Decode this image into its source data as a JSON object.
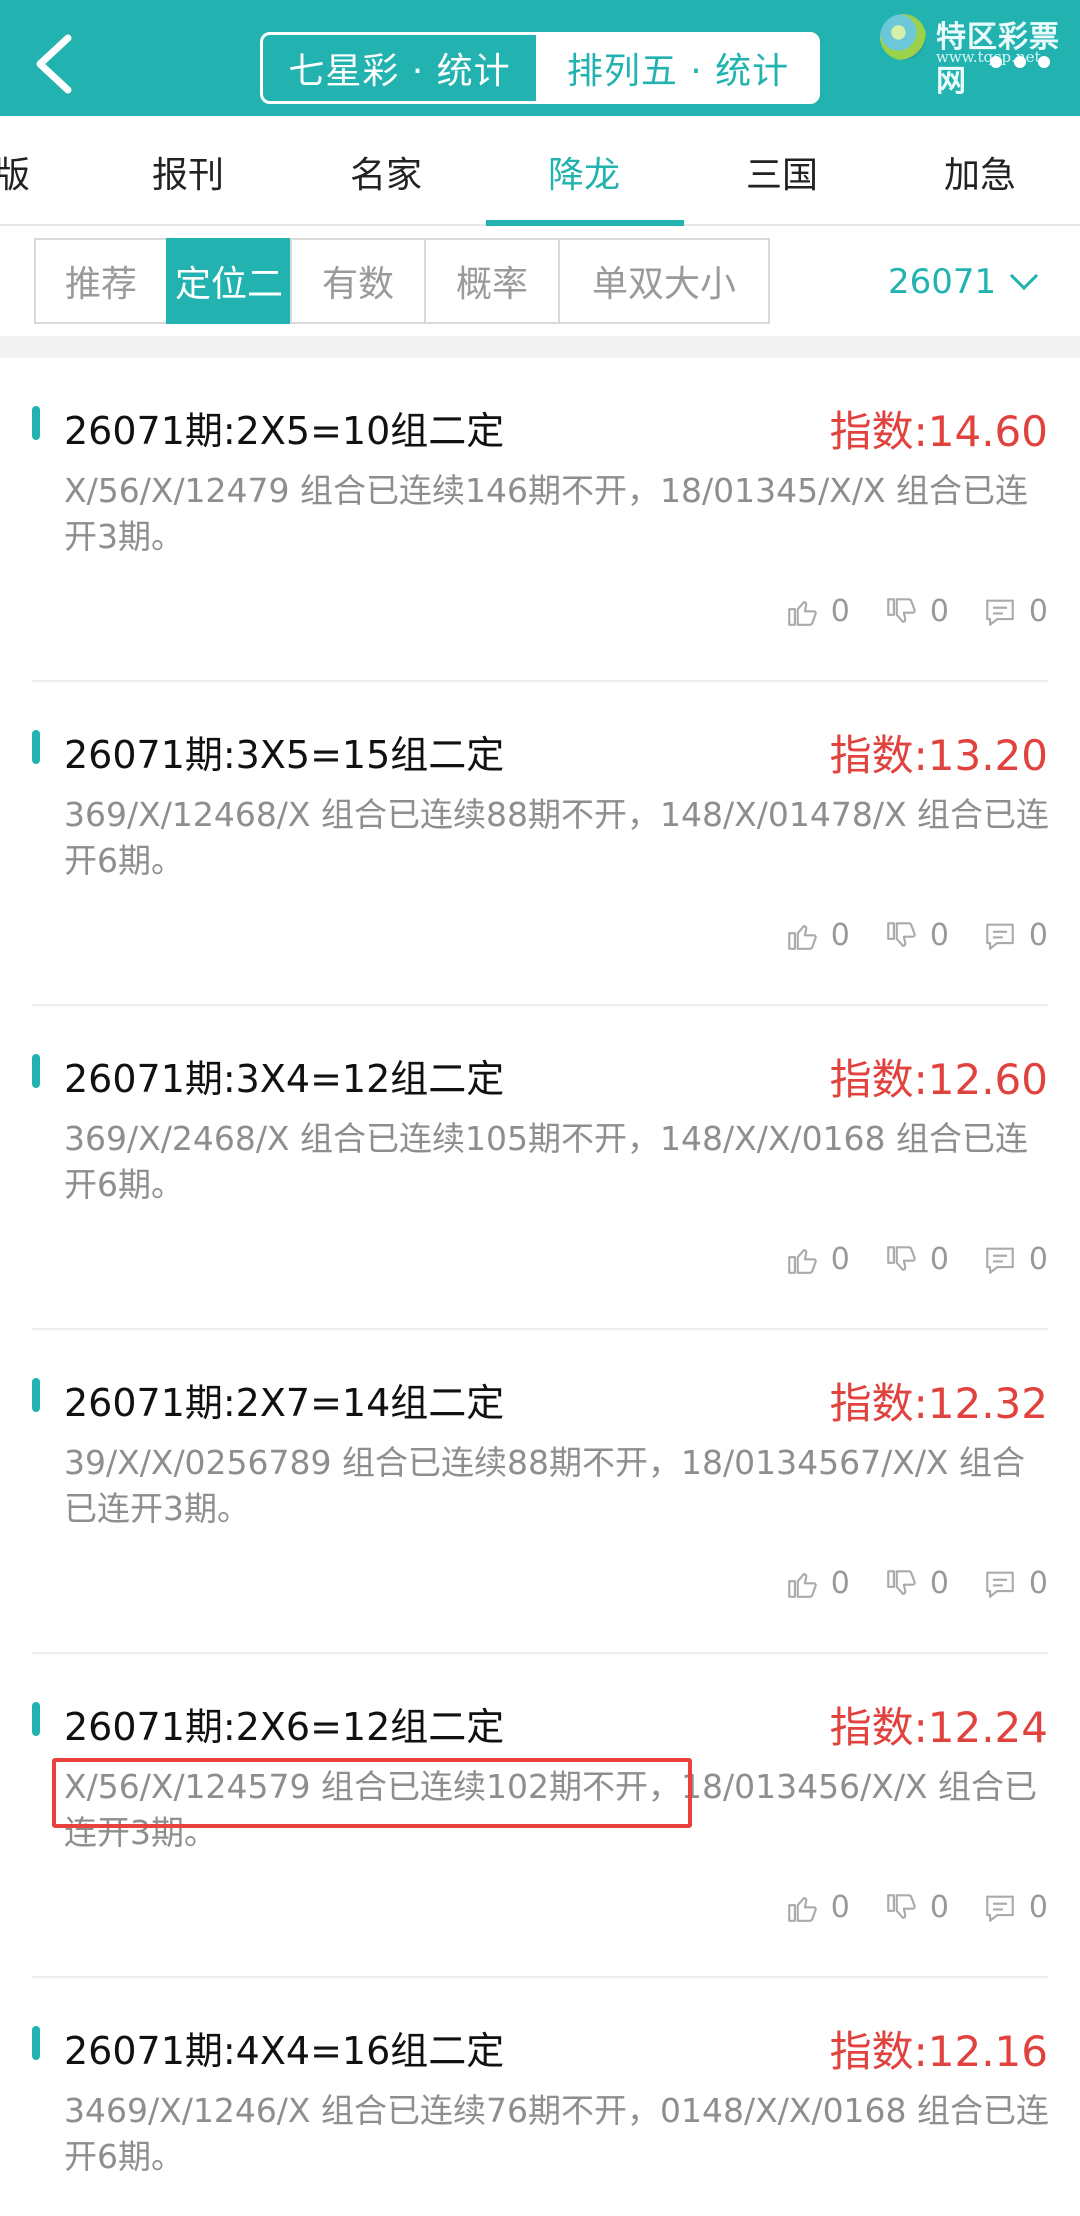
{
  "header": {
    "segments": [
      "七星彩 · 统计",
      "排列五 · 统计"
    ],
    "logo": {
      "title": "特区彩票网",
      "url": "www.tqcp.net"
    }
  },
  "tabs": [
    "版",
    "报刊",
    "名家",
    "降龙",
    "三国",
    "加急"
  ],
  "subtabs": [
    "推荐",
    "定位二",
    "有数",
    "概率",
    "单双大小"
  ],
  "issue": "26071",
  "items": [
    {
      "title": "26071期:2X5=10组二定",
      "score": "指数:14.60",
      "desc": "X/56/X/12479 组合已连续146期不开，18/01345/X/X 组合已连开3期。",
      "likes": "0",
      "dislikes": "0",
      "comments": "0"
    },
    {
      "title": "26071期:3X5=15组二定",
      "score": "指数:13.20",
      "desc": "369/X/12468/X 组合已连续88期不开，148/X/01478/X 组合已连开6期。",
      "likes": "0",
      "dislikes": "0",
      "comments": "0"
    },
    {
      "title": "26071期:3X4=12组二定",
      "score": "指数:12.60",
      "desc": "369/X/2468/X 组合已连续105期不开，148/X/X/0168 组合已连开6期。",
      "likes": "0",
      "dislikes": "0",
      "comments": "0"
    },
    {
      "title": "26071期:2X7=14组二定",
      "score": "指数:12.32",
      "desc": "39/X/X/0256789 组合已连续88期不开，18/0134567/X/X 组合已连开3期。",
      "likes": "0",
      "dislikes": "0",
      "comments": "0"
    },
    {
      "title": "26071期:2X6=12组二定",
      "score": "指数:12.24",
      "desc": "X/56/X/124579 组合已连续102期不开，18/013456/X/X 组合已连开3期。",
      "likes": "0",
      "dislikes": "0",
      "comments": "0"
    },
    {
      "title": "26071期:4X4=16组二定",
      "score": "指数:12.16",
      "desc": "3469/X/1246/X 组合已连续76期不开，0148/X/X/0168 组合已连开6期。",
      "likes": "0",
      "dislikes": "0",
      "comments": "0"
    }
  ]
}
